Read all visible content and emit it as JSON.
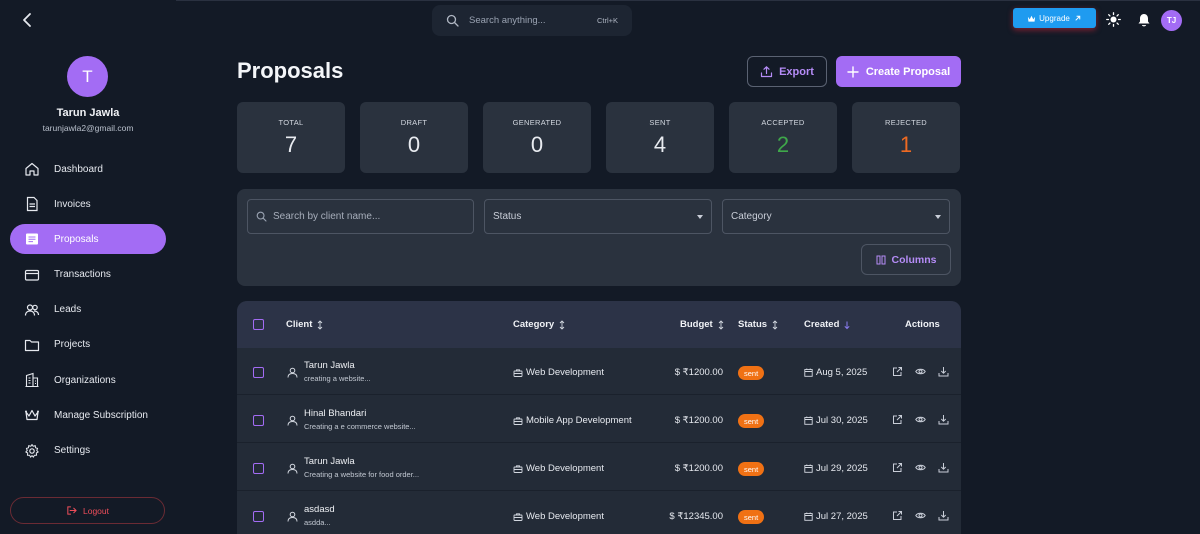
{
  "topbar": {
    "search_placeholder": "Search anything...",
    "search_shortcut": "Ctrl+K",
    "upgrade_label": "Upgrade",
    "user_initials": "TJ"
  },
  "profile": {
    "initial": "T",
    "name": "Tarun Jawla",
    "email": "tarunjawla2@gmail.com"
  },
  "sidebar": {
    "items": [
      {
        "label": "Dashboard",
        "icon": "home-icon"
      },
      {
        "label": "Invoices",
        "icon": "file-icon"
      },
      {
        "label": "Proposals",
        "icon": "list-icon",
        "active": true
      },
      {
        "label": "Transactions",
        "icon": "card-icon"
      },
      {
        "label": "Leads",
        "icon": "users-icon"
      },
      {
        "label": "Projects",
        "icon": "folder-icon"
      },
      {
        "label": "Organizations",
        "icon": "building-icon"
      },
      {
        "label": "Manage Subscription",
        "icon": "crown-icon"
      },
      {
        "label": "Settings",
        "icon": "gear-icon"
      }
    ],
    "logout_label": "Logout"
  },
  "page": {
    "title": "Proposals",
    "export_label": "Export",
    "create_label": "Create Proposal"
  },
  "stats": [
    {
      "label": "TOTAL",
      "value": "7",
      "color": "#e8ebf0"
    },
    {
      "label": "DRAFT",
      "value": "0",
      "color": "#e8ebf0"
    },
    {
      "label": "GENERATED",
      "value": "0",
      "color": "#e8ebf0"
    },
    {
      "label": "SENT",
      "value": "4",
      "color": "#e8ebf0"
    },
    {
      "label": "ACCEPTED",
      "value": "2",
      "color": "#3fa84a"
    },
    {
      "label": "REJECTED",
      "value": "1",
      "color": "#ee6a22"
    }
  ],
  "filters": {
    "search_placeholder": "Search by client name...",
    "status_label": "Status",
    "category_label": "Category",
    "columns_label": "Columns"
  },
  "table": {
    "headers": {
      "client": "Client",
      "category": "Category",
      "budget": "Budget",
      "status": "Status",
      "created": "Created",
      "actions": "Actions"
    },
    "rows": [
      {
        "client": "Tarun Jawla",
        "desc": "creating a website...",
        "category": "Web Development",
        "budget": "$ ₹1200.00",
        "status": "sent",
        "created": "Aug 5, 2025"
      },
      {
        "client": "Hinal Bhandari",
        "desc": "Creating a e commerce website...",
        "category": "Mobile App Development",
        "budget": "$ ₹1200.00",
        "status": "sent",
        "created": "Jul 30, 2025"
      },
      {
        "client": "Tarun Jawla",
        "desc": "Creating a website for food order...",
        "category": "Web Development",
        "budget": "$ ₹1200.00",
        "status": "sent",
        "created": "Jul 29, 2025"
      },
      {
        "client": "asdasd",
        "desc": "asdda...",
        "category": "Web Development",
        "budget": "$ ₹12345.00",
        "status": "sent",
        "created": "Jul 27, 2025"
      }
    ]
  }
}
